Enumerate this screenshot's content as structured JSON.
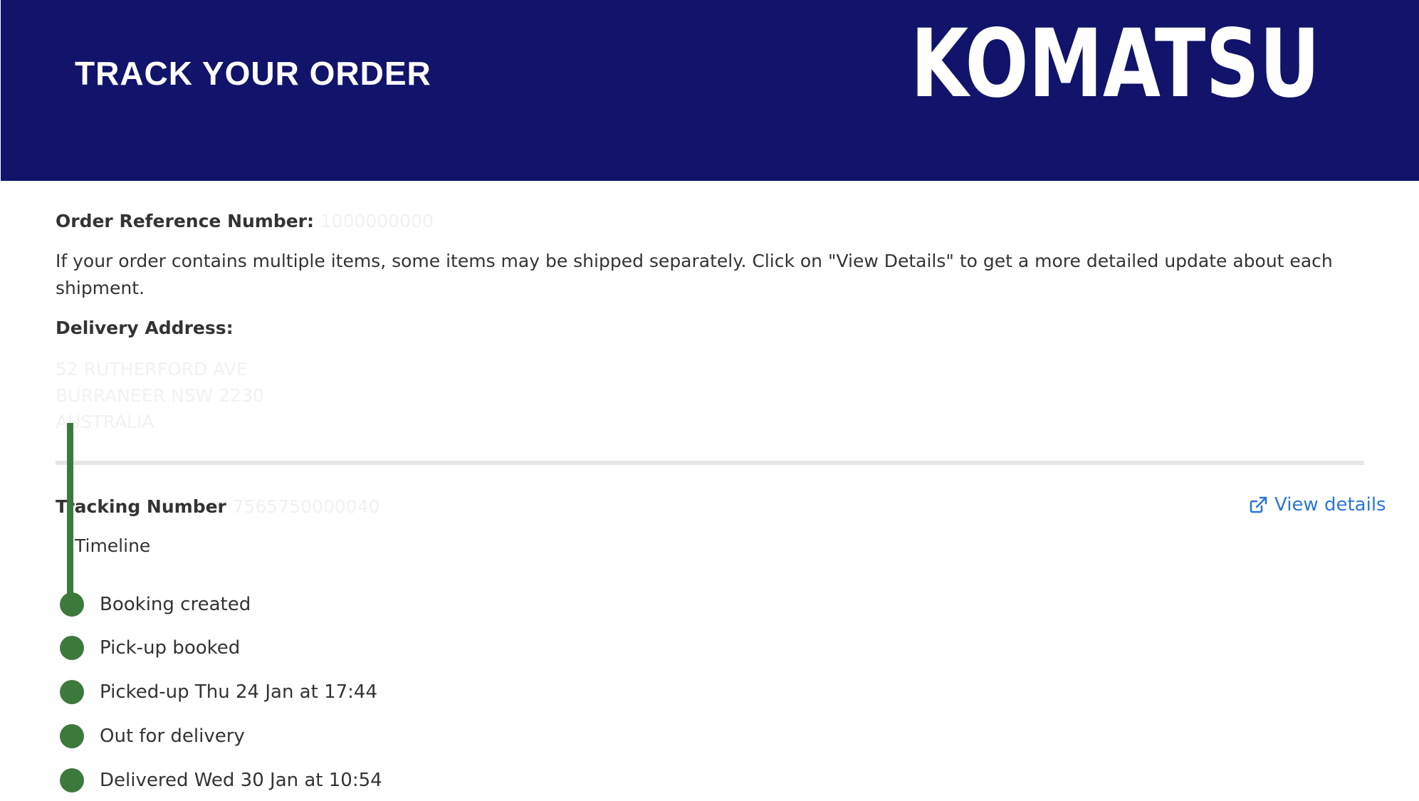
{
  "header": {
    "title": "TRACK YOUR ORDER",
    "logo_text": "KOMATSU",
    "background_color": "#11146a"
  },
  "order": {
    "reference_label": "Order Reference Number:",
    "reference_value": "1000000000"
  },
  "info_text": "If your order contains multiple items, some items may be shipped separately. Click on \"View Details\" to get a more detailed update about each shipment.",
  "delivery": {
    "label": "Delivery Address:",
    "address_lines": [
      "52 RUTHERFORD AVE",
      "BURRANEER NSW 2230",
      "AUSTRALIA"
    ]
  },
  "tracking": {
    "label": "Tracking Number",
    "value": "7565750000040",
    "view_details_label": "View details",
    "view_details_icon": "external-link-icon",
    "link_color": "#2b76d2"
  },
  "timeline": {
    "label": "Timeline",
    "color": "#3b7a3c",
    "events": [
      {
        "text": "Booking created"
      },
      {
        "text": "Pick-up booked"
      },
      {
        "text": "Picked-up Thu 24 Jan at 17:44"
      },
      {
        "text": "Out for delivery"
      },
      {
        "text": "Delivered Wed 30 Jan at 10:54"
      }
    ]
  }
}
